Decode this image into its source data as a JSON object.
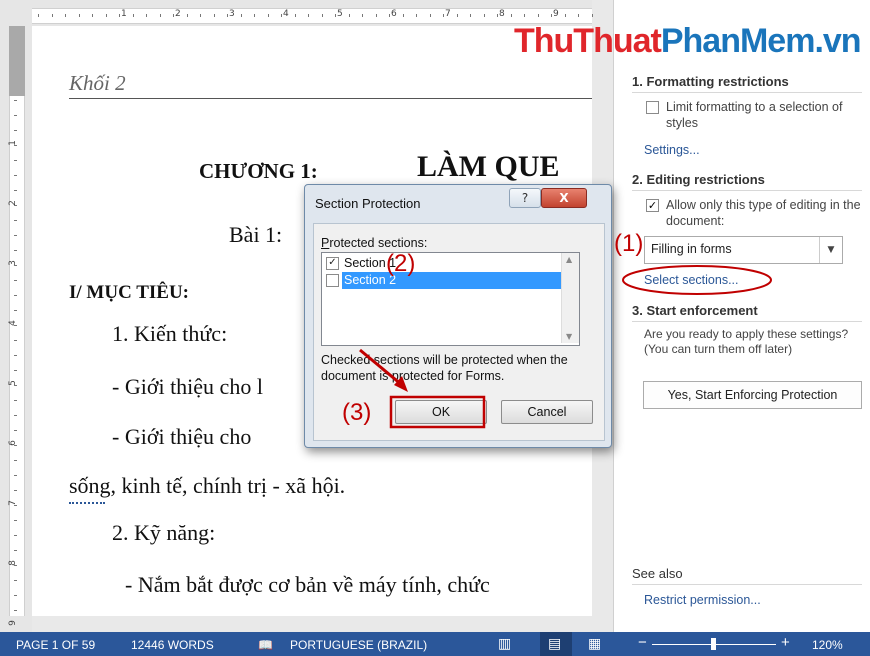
{
  "ruler": {
    "tab_selector": "L",
    "h_numbers": [
      "1",
      "2",
      "3",
      "4",
      "5",
      "6",
      "7",
      "8",
      "9"
    ],
    "v_numbers": [
      "1",
      "2",
      "3",
      "4",
      "5",
      "6",
      "7",
      "8",
      "9"
    ]
  },
  "document": {
    "header": "Khối 2",
    "chapter": "CHƯƠNG 1:",
    "chapter_title": "LÀM QUE",
    "lesson": "Bài 1:",
    "section1": "I/ MỤC TIÊU:",
    "item1": "1. Kiến thức:",
    "line1": "- Giới thiệu cho l",
    "line2": "- Giới thiệu cho",
    "line3": "sống, kinh tế, chính trị - xã hội.",
    "item2": "2. Kỹ năng:",
    "line4": "- Nắm bắt được cơ bản về máy tính, chức"
  },
  "watermark": {
    "part1": "ThuThuat",
    "part2": "PhanMem",
    "part3": ".vn"
  },
  "pane": {
    "formatting_title": "1. Formatting restrictions",
    "limit_formatting": "Limit formatting to a selection of styles",
    "settings_link": "Settings...",
    "editing_title": "2. Editing restrictions",
    "allow_editing": "Allow only this type of editing in the document:",
    "editing_type": "Filling in forms",
    "select_sections": "Select sections...",
    "enforcement_title": "3. Start enforcement",
    "enforcement_text": "Are you ready to apply these settings? (You can turn them off later)",
    "enforce_button": "Yes, Start Enforcing Protection",
    "see_also": "See also",
    "restrict_permission": "Restrict permission..."
  },
  "dialog": {
    "title": "Section Protection",
    "help": "?",
    "close": "X",
    "protected_label": "Protected sections:",
    "sections": [
      {
        "label": "Section 1",
        "checked": true,
        "selected": false
      },
      {
        "label": "Section 2",
        "checked": false,
        "selected": true
      }
    ],
    "info": "Checked sections will be protected when the document is protected for Forms.",
    "ok": "OK",
    "cancel": "Cancel"
  },
  "annotations": {
    "a1": "(1)",
    "a2": "(2)",
    "a3": "(3)"
  },
  "status": {
    "page": "PAGE 1 OF 59",
    "words": "12446 WORDS",
    "language": "PORTUGUESE (BRAZIL)",
    "zoom": "120%",
    "zoom_minus": "−",
    "zoom_plus": "+"
  },
  "colors": {
    "accent": "#2b579a",
    "annotation": "#c00000",
    "selection": "#3399ff",
    "link": "#2b5797"
  }
}
